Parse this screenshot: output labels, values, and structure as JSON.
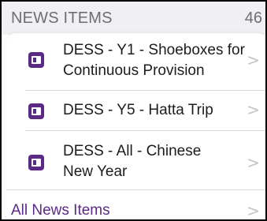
{
  "section": {
    "title": "NEWS ITEMS",
    "count": "46"
  },
  "news_items": [
    {
      "line1": "DESS - Y1 - Shoeboxes for",
      "line2": "Continuous Provision",
      "icon": "news-icon"
    },
    {
      "line1": "DESS - Y5 - Hatta Trip",
      "line2": "",
      "icon": "news-icon"
    },
    {
      "line1": "DESS - All - Chinese",
      "line2": "New Year",
      "icon": "news-icon"
    }
  ],
  "footer": {
    "all_label": "All News Items"
  },
  "colors": {
    "accent": "#5b2a86",
    "header_bg": "#efeff4",
    "header_text": "#6d6d72",
    "chevron": "#c4c4c7"
  },
  "chevron_glyph": ">"
}
